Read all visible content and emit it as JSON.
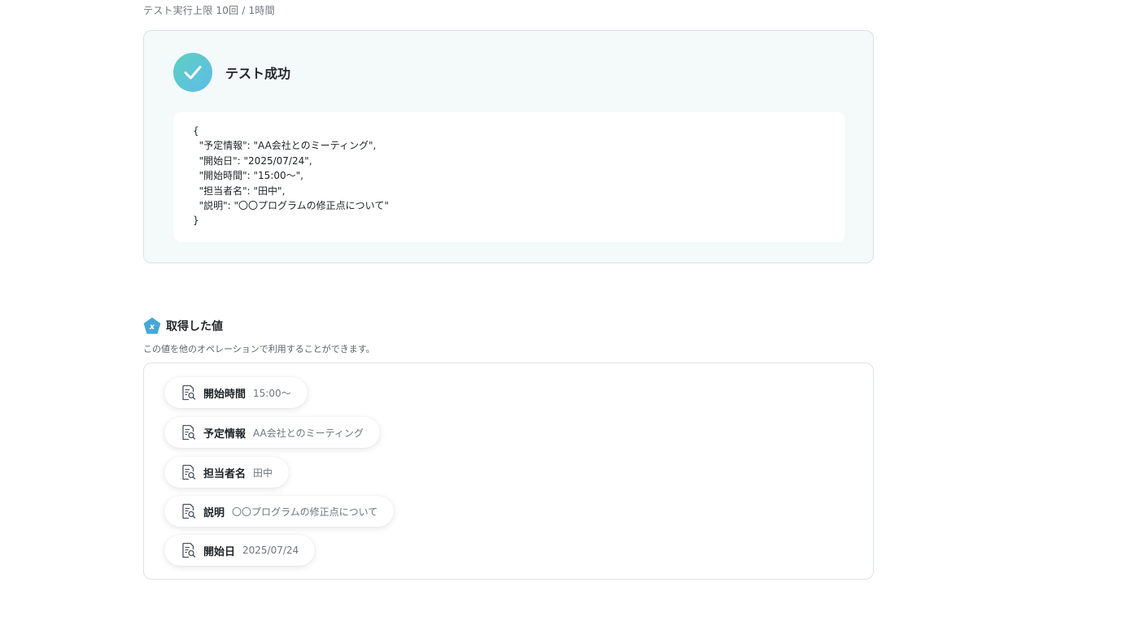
{
  "header": {
    "limit_note": "テスト実行上限 10回 / 1時間"
  },
  "result": {
    "title": "テスト成功",
    "json_lines": [
      "{",
      "  \"予定情報\": \"AA会社とのミーティング\",",
      "  \"開始日\": \"2025/07/24\",",
      "  \"開始時間\": \"15:00〜\",",
      "  \"担当者名\": \"田中\",",
      "  \"説明\": \"〇〇プログラムの修正点について\"",
      "}"
    ]
  },
  "values_section": {
    "title": "取得した値",
    "description": "この値を他のオペレーションで利用することができます。",
    "icon_letter": "x",
    "items": [
      {
        "key": "開始時間",
        "value": "15:00〜"
      },
      {
        "key": "予定情報",
        "value": "AA会社とのミーティング"
      },
      {
        "key": "担当者名",
        "value": "田中"
      },
      {
        "key": "説明",
        "value": "〇〇プログラムの修正点について"
      },
      {
        "key": "開始日",
        "value": "2025/07/24"
      }
    ]
  },
  "colors": {
    "success_gradient_start": "#5ccfc1",
    "success_gradient_end": "#5fbde8",
    "panel_bg": "#f4f9f9",
    "section_icon": "#46a7d9"
  },
  "icons": {
    "success": "check-icon",
    "section": "variable-pentagon-icon",
    "chip": "document-search-icon"
  }
}
